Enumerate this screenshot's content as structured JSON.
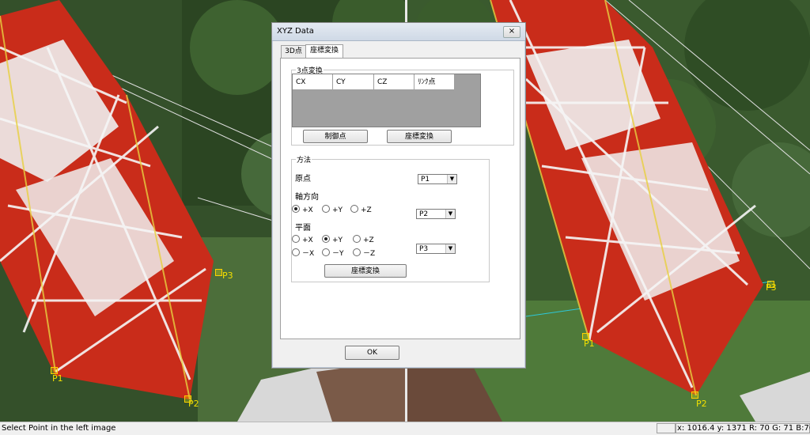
{
  "viewers": {
    "left": {
      "points": [
        {
          "label": "P1"
        },
        {
          "label": "P2"
        },
        {
          "label": "P3"
        }
      ]
    },
    "right": {
      "points": [
        {
          "label": "P1"
        },
        {
          "label": "P2"
        },
        {
          "label": "P3"
        }
      ]
    }
  },
  "status": {
    "message": "Select Point in the left image",
    "coords": "x: 1016.4 y: 1371 R: 70 G: 71 B:76"
  },
  "dialog": {
    "title": "XYZ Data",
    "close_label": "×",
    "tabs": [
      {
        "label": "3D点",
        "active": false
      },
      {
        "label": "座標変換",
        "active": true
      }
    ],
    "three_point": {
      "title": "3点変換",
      "columns": [
        "CX",
        "CY",
        "CZ",
        "ﾘﾝｸ点"
      ],
      "control_points_button": "制御点",
      "transform_button": "座標変換"
    },
    "method": {
      "title": "方法",
      "origin_label": "原点",
      "origin_value": "P1",
      "axis_label": "軸方向",
      "axis_options": [
        "+X",
        "+Y",
        "+Z"
      ],
      "axis_selected": "+X",
      "axis_value": "P2",
      "plane_label": "平面",
      "plane_options": [
        "+X",
        "+Y",
        "+Z",
        "－X",
        "－Y",
        "－Z"
      ],
      "plane_selected": "+Y",
      "plane_value": "P3",
      "transform_button": "座標変換"
    },
    "ok_label": "OK"
  },
  "colors": {
    "tower_red": "#d8321e",
    "tower_white": "#f4f4f4",
    "foliage": "#35502a",
    "point_label": "#f2e000",
    "measure_line": "#2ec8d8"
  }
}
